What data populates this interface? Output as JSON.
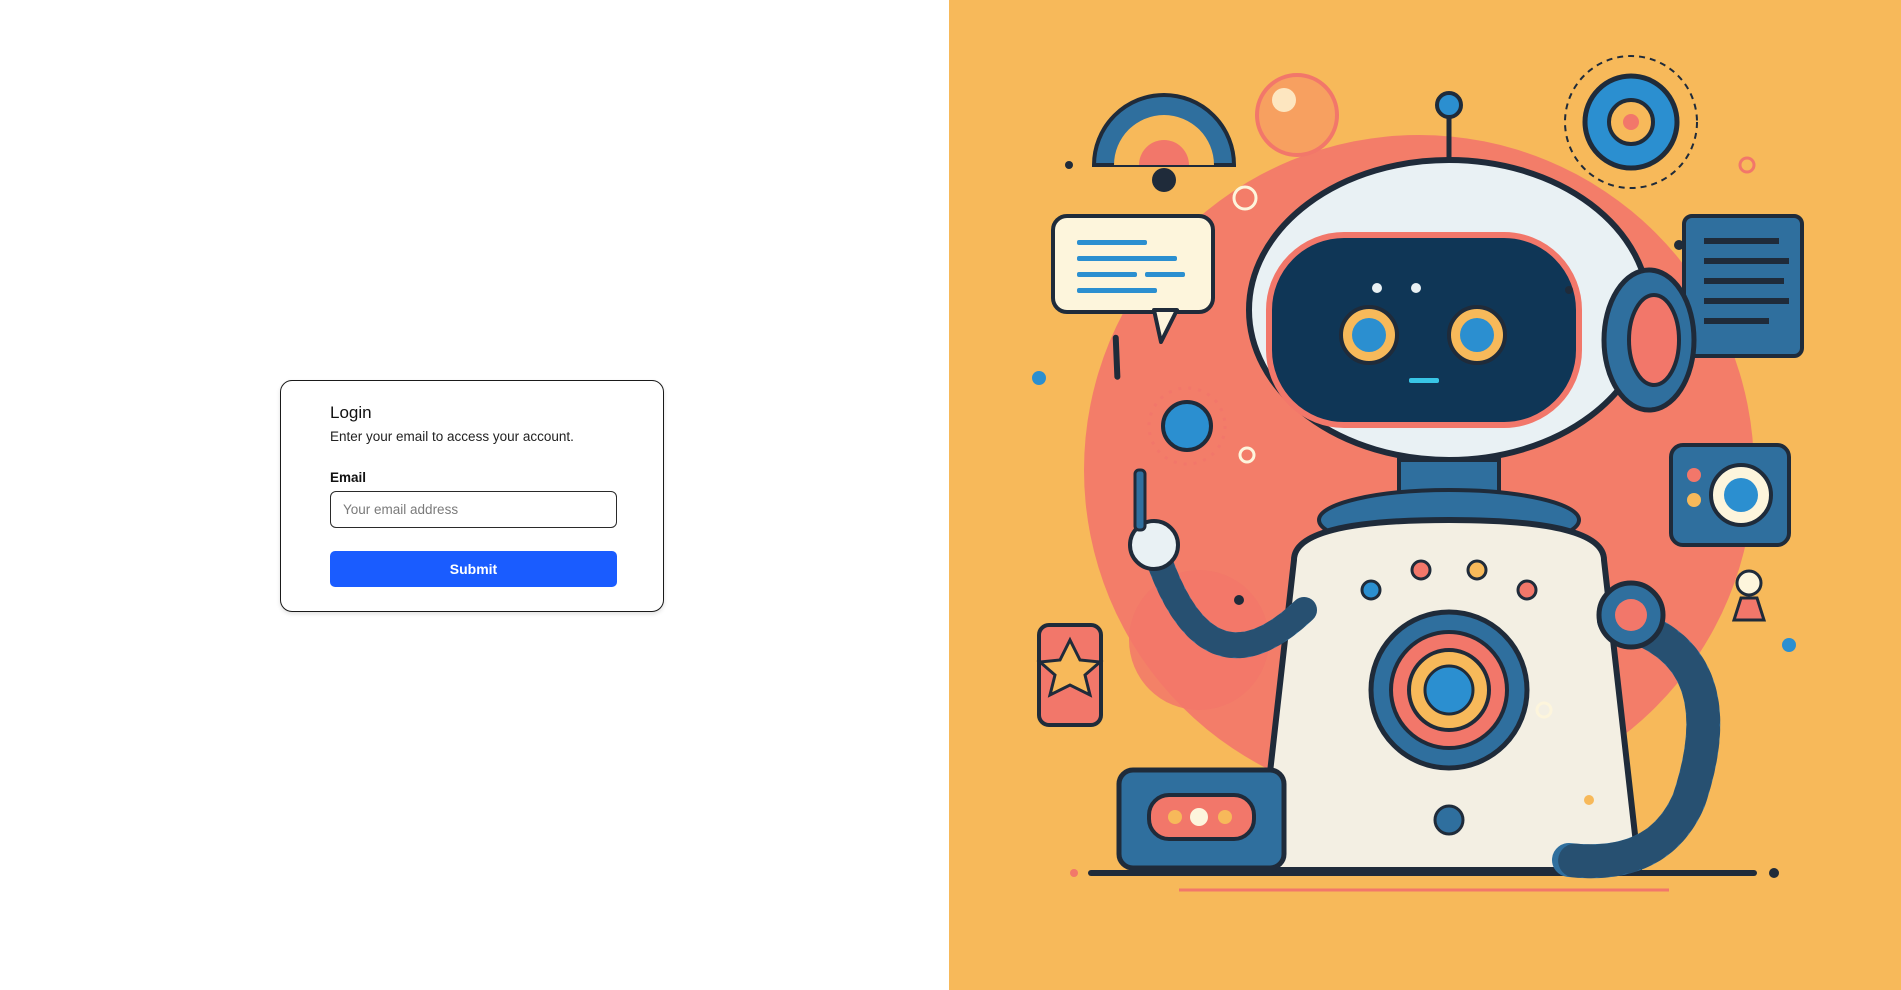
{
  "login": {
    "title": "Login",
    "subtitle": "Enter your email to access your account.",
    "email_label": "Email",
    "email_placeholder": "Your email address",
    "email_value": "",
    "submit_label": "Submit"
  },
  "hero": {
    "description_icon": "robot-illustration"
  },
  "colors": {
    "accent": "#1a5cff",
    "hero_background": "#f7b95a",
    "hero_blob": "#f2776a",
    "robot_blue": "#2f6f9e",
    "robot_body": "#f3efe3"
  }
}
